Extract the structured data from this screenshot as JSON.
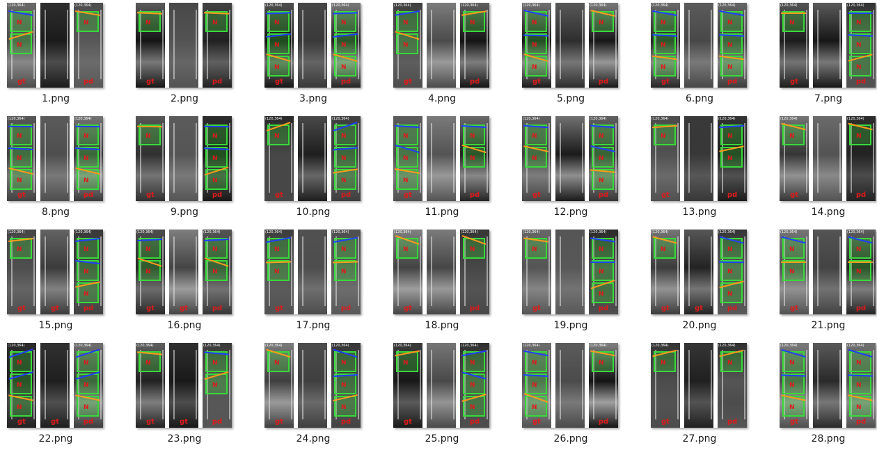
{
  "items": [
    {
      "name": "1.png",
      "labels": [
        "gt",
        "",
        "pd"
      ],
      "coord": "(120,364)"
    },
    {
      "name": "2.png",
      "labels": [
        "gt",
        "",
        "pd"
      ],
      "coord": ""
    },
    {
      "name": "3.png",
      "labels": [
        "gt",
        "",
        "pd"
      ],
      "coord": "(120,364)"
    },
    {
      "name": "4.png",
      "labels": [
        "gt",
        "",
        "pd"
      ],
      "coord": "(120,364)"
    },
    {
      "name": "5.png",
      "labels": [
        "gt",
        "",
        "pd"
      ],
      "coord": "(120,364)"
    },
    {
      "name": "6.png",
      "labels": [
        "gt",
        "",
        "pd"
      ],
      "coord": "(120,364)"
    },
    {
      "name": "7.png",
      "labels": [
        "gt",
        "",
        "pd"
      ],
      "coord": "(120,364)"
    },
    {
      "name": "8.png",
      "labels": [
        "gt",
        "",
        "pd"
      ],
      "coord": "(120,364)"
    },
    {
      "name": "9.png",
      "labels": [
        "gt",
        "",
        "pd"
      ],
      "coord": ""
    },
    {
      "name": "10.png",
      "labels": [
        "gt",
        "",
        "pd"
      ],
      "coord": "(120,364)"
    },
    {
      "name": "11.png",
      "labels": [
        "gt",
        "",
        "pd"
      ],
      "coord": ""
    },
    {
      "name": "12.png",
      "labels": [
        "gt",
        "",
        "pd"
      ],
      "coord": "(120,364)"
    },
    {
      "name": "13.png",
      "labels": [
        "gt",
        "",
        "pd"
      ],
      "coord": "(120,364)"
    },
    {
      "name": "14.png",
      "labels": [
        "gt",
        "",
        "pd"
      ],
      "coord": "(120,364)"
    },
    {
      "name": "15.png",
      "labels": [
        "gt",
        "gt",
        "pd"
      ],
      "coord": "(120,364)"
    },
    {
      "name": "16.png",
      "labels": [
        "gt",
        "gt",
        "pd"
      ],
      "coord": "(120,364)"
    },
    {
      "name": "17.png",
      "labels": [
        "gt",
        "",
        "pd"
      ],
      "coord": "(120,364)"
    },
    {
      "name": "18.png",
      "labels": [
        "gt",
        "",
        "pd"
      ],
      "coord": "(120,364)"
    },
    {
      "name": "19.png",
      "labels": [
        "gt",
        "",
        "pd"
      ],
      "coord": "(120,364)"
    },
    {
      "name": "20.png",
      "labels": [
        "gt",
        "gt",
        "pd"
      ],
      "coord": "(120,364)"
    },
    {
      "name": "21.png",
      "labels": [
        "gt",
        "",
        "pd"
      ],
      "coord": "(120,364)"
    },
    {
      "name": "22.png",
      "labels": [
        "gt",
        "gt",
        "pd"
      ],
      "coord": "(120,364)"
    },
    {
      "name": "23.png",
      "labels": [
        "gt",
        "gt",
        "pd"
      ],
      "coord": "(120,364)"
    },
    {
      "name": "24.png",
      "labels": [
        "gt",
        "",
        "pd"
      ],
      "coord": "(120,364)"
    },
    {
      "name": "25.png",
      "labels": [
        "gt",
        "",
        "pd"
      ],
      "coord": "(120,364)"
    },
    {
      "name": "26.png",
      "labels": [
        "gt",
        "",
        "pd"
      ],
      "coord": "(120,364)"
    },
    {
      "name": "27.png",
      "labels": [
        "gt",
        "",
        "pd"
      ],
      "coord": "(120,364)"
    },
    {
      "name": "28.png",
      "labels": [
        "gt",
        "",
        "pd"
      ],
      "coord": "(120,364)"
    }
  ],
  "colors": {
    "slot_box": "#39d93a",
    "arrow": "#1f3fff",
    "arrow_alt": "#ff9a1a",
    "label": "#e01a1a"
  }
}
